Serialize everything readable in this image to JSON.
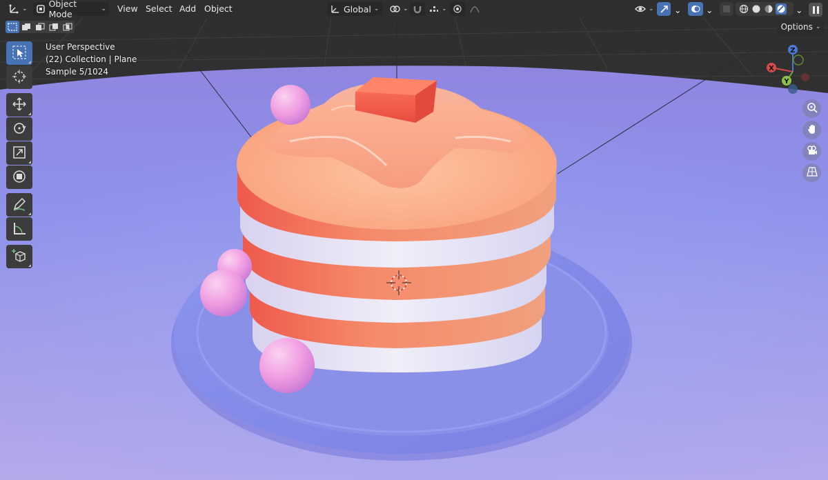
{
  "header": {
    "editor_type_icon": "axes-editor-icon",
    "mode_label": "Object Mode",
    "menus": [
      "View",
      "Select",
      "Add",
      "Object"
    ],
    "orientation_label": "Global",
    "options_label": "Options"
  },
  "overlay": {
    "line1": "User Perspective",
    "line2": "(22) Collection | Plane",
    "line3": "Sample 5/1024"
  },
  "gizmo": {
    "x": "X",
    "y": "Y",
    "z": "Z"
  },
  "tools": [
    {
      "name": "select-box-tool",
      "icon": "cursor-select-icon",
      "active": true
    },
    {
      "name": "cursor-tool",
      "icon": "crosshair-cursor-icon",
      "active": false
    },
    {
      "name": "move-tool",
      "icon": "move-arrows-icon",
      "active": false
    },
    {
      "name": "rotate-tool",
      "icon": "rotate-icon",
      "active": false
    },
    {
      "name": "scale-tool",
      "icon": "scale-icon",
      "active": false
    },
    {
      "name": "transform-tool",
      "icon": "transform-icon",
      "active": false
    },
    {
      "name": "annotate-tool",
      "icon": "pencil-icon",
      "active": false
    },
    {
      "name": "measure-tool",
      "icon": "ruler-icon",
      "active": false
    },
    {
      "name": "add-cube-tool",
      "icon": "add-cube-icon",
      "active": false
    }
  ],
  "colors": {
    "accent": "#4772b3",
    "floor": "#8e90e8",
    "pancake": "#f6a07a",
    "cream": "#e8e6f4",
    "butter": "#f06450",
    "berry": "#f2a6e2"
  }
}
